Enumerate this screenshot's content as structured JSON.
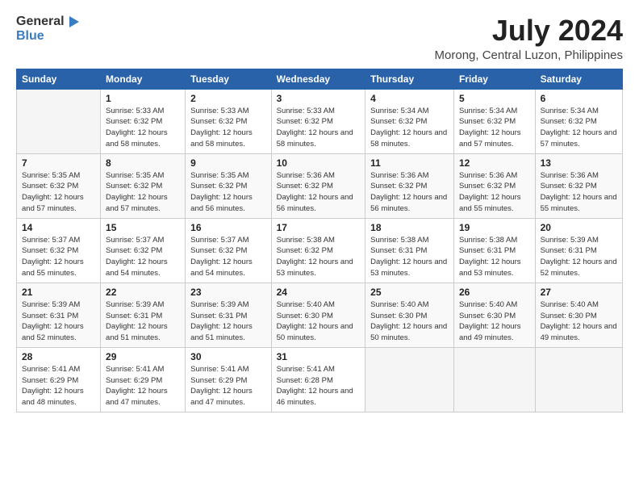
{
  "header": {
    "logo_general": "General",
    "logo_blue": "Blue",
    "month_year": "July 2024",
    "location": "Morong, Central Luzon, Philippines"
  },
  "days_of_week": [
    "Sunday",
    "Monday",
    "Tuesday",
    "Wednesday",
    "Thursday",
    "Friday",
    "Saturday"
  ],
  "weeks": [
    [
      {
        "day": "",
        "sunrise": "",
        "sunset": "",
        "daylight": ""
      },
      {
        "day": "1",
        "sunrise": "Sunrise: 5:33 AM",
        "sunset": "Sunset: 6:32 PM",
        "daylight": "Daylight: 12 hours and 58 minutes."
      },
      {
        "day": "2",
        "sunrise": "Sunrise: 5:33 AM",
        "sunset": "Sunset: 6:32 PM",
        "daylight": "Daylight: 12 hours and 58 minutes."
      },
      {
        "day": "3",
        "sunrise": "Sunrise: 5:33 AM",
        "sunset": "Sunset: 6:32 PM",
        "daylight": "Daylight: 12 hours and 58 minutes."
      },
      {
        "day": "4",
        "sunrise": "Sunrise: 5:34 AM",
        "sunset": "Sunset: 6:32 PM",
        "daylight": "Daylight: 12 hours and 58 minutes."
      },
      {
        "day": "5",
        "sunrise": "Sunrise: 5:34 AM",
        "sunset": "Sunset: 6:32 PM",
        "daylight": "Daylight: 12 hours and 57 minutes."
      },
      {
        "day": "6",
        "sunrise": "Sunrise: 5:34 AM",
        "sunset": "Sunset: 6:32 PM",
        "daylight": "Daylight: 12 hours and 57 minutes."
      }
    ],
    [
      {
        "day": "7",
        "sunrise": "Sunrise: 5:35 AM",
        "sunset": "Sunset: 6:32 PM",
        "daylight": "Daylight: 12 hours and 57 minutes."
      },
      {
        "day": "8",
        "sunrise": "Sunrise: 5:35 AM",
        "sunset": "Sunset: 6:32 PM",
        "daylight": "Daylight: 12 hours and 57 minutes."
      },
      {
        "day": "9",
        "sunrise": "Sunrise: 5:35 AM",
        "sunset": "Sunset: 6:32 PM",
        "daylight": "Daylight: 12 hours and 56 minutes."
      },
      {
        "day": "10",
        "sunrise": "Sunrise: 5:36 AM",
        "sunset": "Sunset: 6:32 PM",
        "daylight": "Daylight: 12 hours and 56 minutes."
      },
      {
        "day": "11",
        "sunrise": "Sunrise: 5:36 AM",
        "sunset": "Sunset: 6:32 PM",
        "daylight": "Daylight: 12 hours and 56 minutes."
      },
      {
        "day": "12",
        "sunrise": "Sunrise: 5:36 AM",
        "sunset": "Sunset: 6:32 PM",
        "daylight": "Daylight: 12 hours and 55 minutes."
      },
      {
        "day": "13",
        "sunrise": "Sunrise: 5:36 AM",
        "sunset": "Sunset: 6:32 PM",
        "daylight": "Daylight: 12 hours and 55 minutes."
      }
    ],
    [
      {
        "day": "14",
        "sunrise": "Sunrise: 5:37 AM",
        "sunset": "Sunset: 6:32 PM",
        "daylight": "Daylight: 12 hours and 55 minutes."
      },
      {
        "day": "15",
        "sunrise": "Sunrise: 5:37 AM",
        "sunset": "Sunset: 6:32 PM",
        "daylight": "Daylight: 12 hours and 54 minutes."
      },
      {
        "day": "16",
        "sunrise": "Sunrise: 5:37 AM",
        "sunset": "Sunset: 6:32 PM",
        "daylight": "Daylight: 12 hours and 54 minutes."
      },
      {
        "day": "17",
        "sunrise": "Sunrise: 5:38 AM",
        "sunset": "Sunset: 6:32 PM",
        "daylight": "Daylight: 12 hours and 53 minutes."
      },
      {
        "day": "18",
        "sunrise": "Sunrise: 5:38 AM",
        "sunset": "Sunset: 6:31 PM",
        "daylight": "Daylight: 12 hours and 53 minutes."
      },
      {
        "day": "19",
        "sunrise": "Sunrise: 5:38 AM",
        "sunset": "Sunset: 6:31 PM",
        "daylight": "Daylight: 12 hours and 53 minutes."
      },
      {
        "day": "20",
        "sunrise": "Sunrise: 5:39 AM",
        "sunset": "Sunset: 6:31 PM",
        "daylight": "Daylight: 12 hours and 52 minutes."
      }
    ],
    [
      {
        "day": "21",
        "sunrise": "Sunrise: 5:39 AM",
        "sunset": "Sunset: 6:31 PM",
        "daylight": "Daylight: 12 hours and 52 minutes."
      },
      {
        "day": "22",
        "sunrise": "Sunrise: 5:39 AM",
        "sunset": "Sunset: 6:31 PM",
        "daylight": "Daylight: 12 hours and 51 minutes."
      },
      {
        "day": "23",
        "sunrise": "Sunrise: 5:39 AM",
        "sunset": "Sunset: 6:31 PM",
        "daylight": "Daylight: 12 hours and 51 minutes."
      },
      {
        "day": "24",
        "sunrise": "Sunrise: 5:40 AM",
        "sunset": "Sunset: 6:30 PM",
        "daylight": "Daylight: 12 hours and 50 minutes."
      },
      {
        "day": "25",
        "sunrise": "Sunrise: 5:40 AM",
        "sunset": "Sunset: 6:30 PM",
        "daylight": "Daylight: 12 hours and 50 minutes."
      },
      {
        "day": "26",
        "sunrise": "Sunrise: 5:40 AM",
        "sunset": "Sunset: 6:30 PM",
        "daylight": "Daylight: 12 hours and 49 minutes."
      },
      {
        "day": "27",
        "sunrise": "Sunrise: 5:40 AM",
        "sunset": "Sunset: 6:30 PM",
        "daylight": "Daylight: 12 hours and 49 minutes."
      }
    ],
    [
      {
        "day": "28",
        "sunrise": "Sunrise: 5:41 AM",
        "sunset": "Sunset: 6:29 PM",
        "daylight": "Daylight: 12 hours and 48 minutes."
      },
      {
        "day": "29",
        "sunrise": "Sunrise: 5:41 AM",
        "sunset": "Sunset: 6:29 PM",
        "daylight": "Daylight: 12 hours and 47 minutes."
      },
      {
        "day": "30",
        "sunrise": "Sunrise: 5:41 AM",
        "sunset": "Sunset: 6:29 PM",
        "daylight": "Daylight: 12 hours and 47 minutes."
      },
      {
        "day": "31",
        "sunrise": "Sunrise: 5:41 AM",
        "sunset": "Sunset: 6:28 PM",
        "daylight": "Daylight: 12 hours and 46 minutes."
      },
      {
        "day": "",
        "sunrise": "",
        "sunset": "",
        "daylight": ""
      },
      {
        "day": "",
        "sunrise": "",
        "sunset": "",
        "daylight": ""
      },
      {
        "day": "",
        "sunrise": "",
        "sunset": "",
        "daylight": ""
      }
    ]
  ]
}
